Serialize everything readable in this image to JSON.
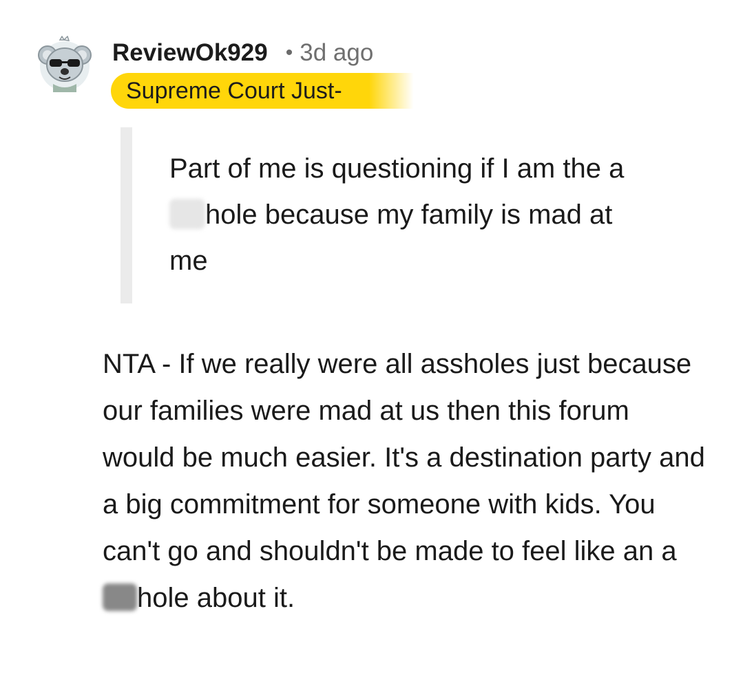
{
  "comment": {
    "username": "ReviewOk929",
    "separator": "•",
    "timestamp": "3d ago",
    "flair": "Supreme Court Just-",
    "quote_text": "Part of me is questioning if I am the a",
    "quote_text_end": "hole because my family is mad at me",
    "body_start": "NTA - If we really were all assholes just because our families were mad at us then this forum would be much easier. It's a destination party and a big commitment for someone with kids. You can't go and shouldn't be made to feel like an a",
    "body_end": "hole about it."
  },
  "icons": {
    "avatar": "koala-sunglasses-avatar"
  },
  "colors": {
    "flair_bg": "#ffd60a",
    "quote_bar": "#ebebeb",
    "meta_text": "#6f6f6f"
  }
}
